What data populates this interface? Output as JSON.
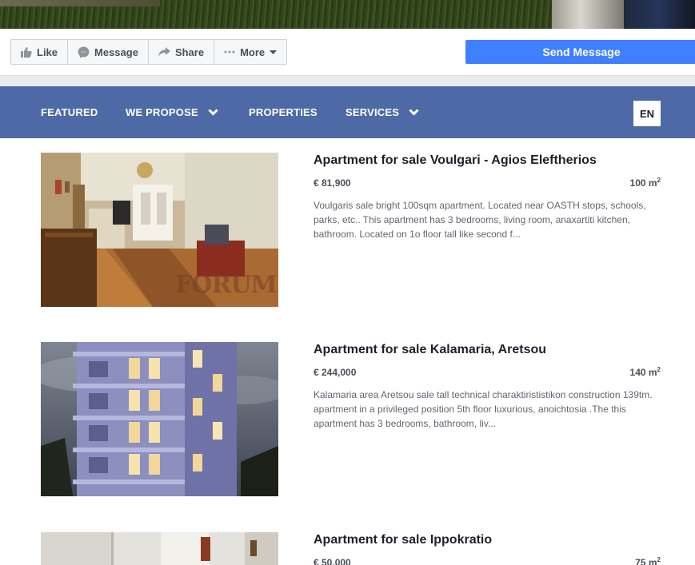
{
  "action_bar": {
    "like_label": "Like",
    "message_label": "Message",
    "share_label": "Share",
    "more_label": "More",
    "send_message_label": "Send Message"
  },
  "nav": {
    "featured": "FEATURED",
    "we_propose": "WE PROPOSE",
    "properties": "PROPERTIES",
    "services": "SERVICES",
    "language": "EN"
  },
  "listings": [
    {
      "title": "Apartment for sale Voulgari - Agios Eleftherios",
      "price": "€ 81,900",
      "area": "100 m",
      "area_sup": "2",
      "description": "Voulgaris sale bright 100sqm apartment. Located near OASTH stops, schools, parks, etc.. This apartment has 3 bedrooms, living room, anaxartiti kitchen, bathroom. Located on 1o floor tall like second f...",
      "watermark": "FORUM"
    },
    {
      "title": "Apartment for sale Kalamaria, Aretsou",
      "price": "€ 244,000",
      "area": "140 m",
      "area_sup": "2",
      "description": "Kalamaria area Aretsou sale tall technical charaktirististikon construction 139tm. apartment in a privileged position 5th floor luxurious, anoichtosia .The this apartment has 3 bedrooms, bathroom, liv..."
    },
    {
      "title": "Apartment for sale Ippokratio",
      "price": "€ 50,000",
      "area": "75 m",
      "area_sup": "2"
    }
  ]
}
